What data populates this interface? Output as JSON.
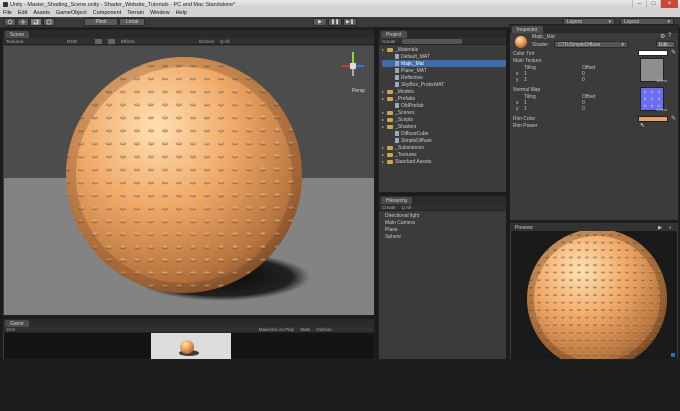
{
  "window": {
    "title": "Unity - Master_Shading_Scene.unity - Shader_Website_Tutorials - PC and Mac Standalone*",
    "controls": [
      "–",
      "□",
      "×"
    ]
  },
  "menu": [
    "File",
    "Edit",
    "Assets",
    "GameObject",
    "Component",
    "Terrain",
    "Window",
    "Help"
  ],
  "toolbar": {
    "tools": [
      "hand-icon",
      "move-icon",
      "rotate-icon",
      "scale-icon"
    ],
    "pivot_label": "Pivot",
    "local_label": "Local",
    "play": "▶",
    "pause": "❚❚",
    "step": "▶❚",
    "layers_label": "Layers",
    "layout_label": "Layout"
  },
  "scene": {
    "tab": "Scene",
    "shading_mode": "Textured",
    "rgb_label": "RGB",
    "effects_label": "Effects",
    "gizmos_label": "Gizmos",
    "all_label": "Q All",
    "persp_label": "Persp",
    "accent_x": "#d33b2b",
    "accent_y": "#8fd34a",
    "accent_z": "#3d6ee8"
  },
  "game": {
    "tab": "Game",
    "aspect": "16:9",
    "maximize": "Maximize on Play",
    "stats": "Stats",
    "gizmos": "Gizmos"
  },
  "project": {
    "tab": "Project",
    "create": "Create",
    "items": [
      {
        "label": "_Materials",
        "type": "folder",
        "depth": 0
      },
      {
        "label": "Default_MAT",
        "type": "file",
        "depth": 1
      },
      {
        "label": "Majic_Mat",
        "type": "file",
        "depth": 1,
        "selected": true
      },
      {
        "label": "Plane_MAT",
        "type": "file",
        "depth": 1
      },
      {
        "label": "Reflective",
        "type": "file",
        "depth": 1
      },
      {
        "label": "SkyBox_ProbeMAT",
        "type": "file",
        "depth": 1
      },
      {
        "label": "_Models",
        "type": "folder",
        "depth": 0
      },
      {
        "label": "_Prefabs",
        "type": "folder",
        "depth": 0
      },
      {
        "label": "OldPrefab",
        "type": "file",
        "depth": 1
      },
      {
        "label": "_Scenes",
        "type": "folder",
        "depth": 0
      },
      {
        "label": "_Scripts",
        "type": "folder",
        "depth": 0
      },
      {
        "label": "_Shaders",
        "type": "folder",
        "depth": 0
      },
      {
        "label": "DiffuseCube",
        "type": "file",
        "depth": 1
      },
      {
        "label": "SimpleDiffuse",
        "type": "file",
        "depth": 1
      },
      {
        "label": "_Substances",
        "type": "folder",
        "depth": 0
      },
      {
        "label": "_Textures",
        "type": "folder",
        "depth": 0
      },
      {
        "label": "Standard Assets",
        "type": "folder",
        "depth": 0
      }
    ]
  },
  "hierarchy": {
    "tab": "Hierarchy",
    "create": "Create",
    "all": "Q All",
    "items": [
      "Directional light",
      "Main Camera",
      "Plane",
      "Sphere"
    ]
  },
  "inspector": {
    "tab": "Inspector",
    "material_name": "Majic_Mat",
    "shader_label": "Shader",
    "shader_value": "CTD/SimpleDiffuse",
    "edit_label": "Edit...",
    "color_tint": "Color Tint",
    "main_texture": "Main Texture",
    "tiling": "Tiling",
    "offset": "Offset",
    "x": "x",
    "y": "y",
    "one": "1",
    "zero": "0",
    "select": "Select",
    "normal_map": "Normal Map",
    "rim_color": "Rim Color",
    "rim_power": "Rim Power",
    "tint_color": "#ffffff",
    "rim_swatch": "#e8a06a",
    "normal_swatch": "#6a6ef0"
  },
  "preview": {
    "tab": "Preview"
  }
}
